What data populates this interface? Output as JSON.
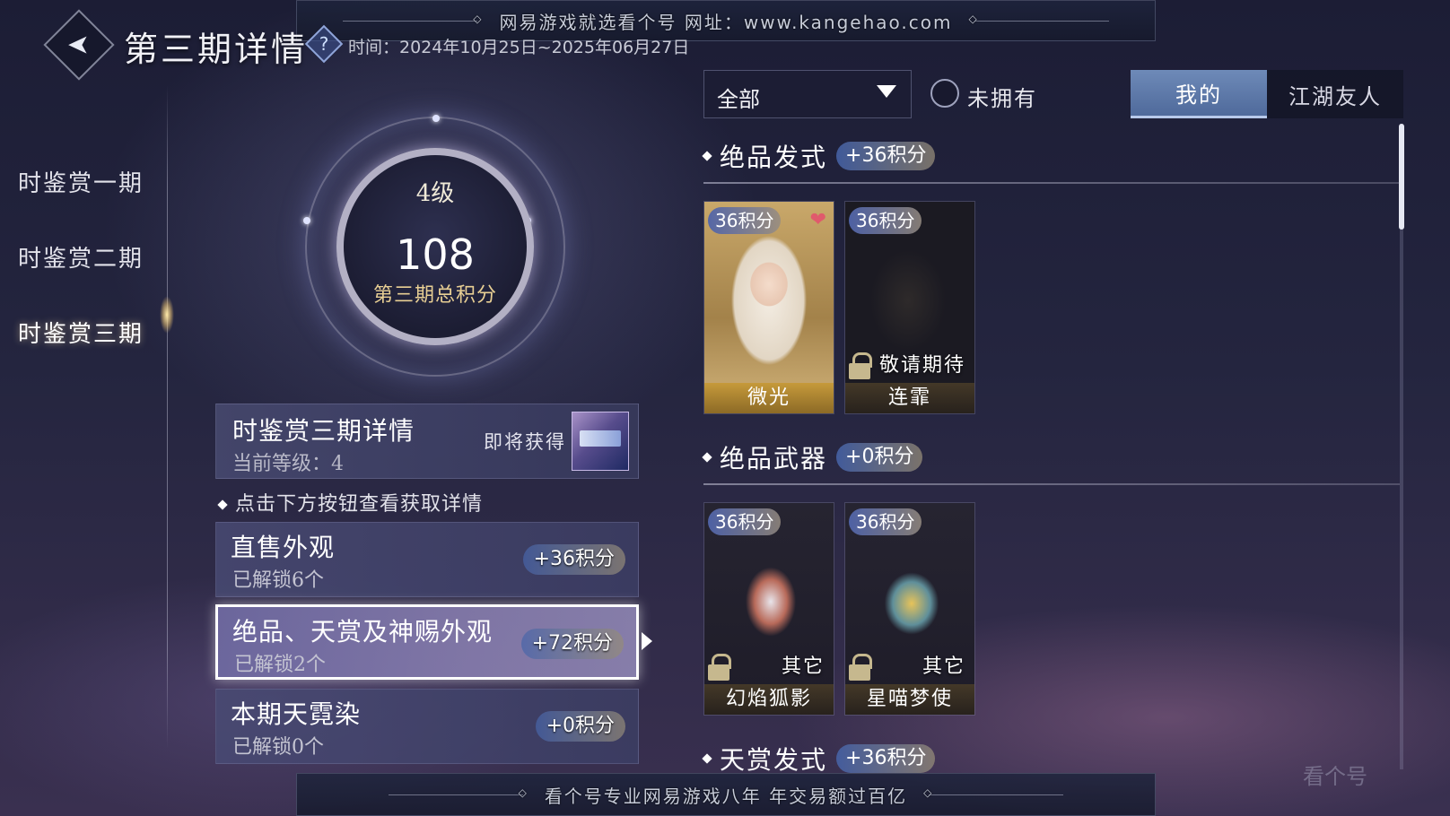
{
  "watermark": {
    "top": "网易游戏就选看个号  网址：www.kangehao.com",
    "bottom": "看个号专业网易游戏八年  年交易额过百亿"
  },
  "header": {
    "title": "第三期详情",
    "help_glyph": "?",
    "back_glyph": "➤",
    "time": "时间：2024年10月25日~2025年06月27日"
  },
  "periods": [
    {
      "label": "时鉴赏一期",
      "active": false
    },
    {
      "label": "时鉴赏二期",
      "active": false
    },
    {
      "label": "时鉴赏三期",
      "active": true
    }
  ],
  "dial": {
    "level": "4级",
    "score": "108",
    "label": "第三期总积分"
  },
  "detail_card": {
    "title": "时鉴赏三期详情",
    "current_level": "当前等级：4",
    "upcoming": "即将获得"
  },
  "hint": "点击下方按钮查看获取详情",
  "categories": [
    {
      "title": "直售外观",
      "unlocked": "已解锁6个",
      "points": "+36积分",
      "selected": false
    },
    {
      "title": "绝品、天赏及神赐外观",
      "unlocked": "已解锁2个",
      "points": "+72积分",
      "selected": true
    },
    {
      "title": "本期天霓染",
      "unlocked": "已解锁0个",
      "points": "+0积分",
      "selected": false
    }
  ],
  "filter": {
    "selected": "全部",
    "unowned_label": "未拥有"
  },
  "tabs": {
    "mine": "我的",
    "friends": "江湖友人"
  },
  "sections": [
    {
      "title": "绝品发式",
      "points": "+36积分",
      "items": [
        {
          "points": "36积分",
          "name": "微光",
          "owned": true,
          "favorite": true,
          "tag": ""
        },
        {
          "points": "36积分",
          "name": "连霏",
          "owned": false,
          "favorite": false,
          "tag": "敬请期待"
        }
      ]
    },
    {
      "title": "绝品武器",
      "points": "+0积分",
      "items": [
        {
          "points": "36积分",
          "name": "幻焰狐影",
          "owned": false,
          "favorite": false,
          "tag": "其它"
        },
        {
          "points": "36积分",
          "name": "星喵梦使",
          "owned": false,
          "favorite": false,
          "tag": "其它"
        }
      ]
    },
    {
      "title": "天赏发式",
      "points": "+36积分",
      "items": []
    }
  ],
  "corner_logo": "看个号",
  "colors": {
    "accent_gold": "#c69a3b",
    "tab_active": "#6e8ab8",
    "favorite": "#e05a6c"
  }
}
